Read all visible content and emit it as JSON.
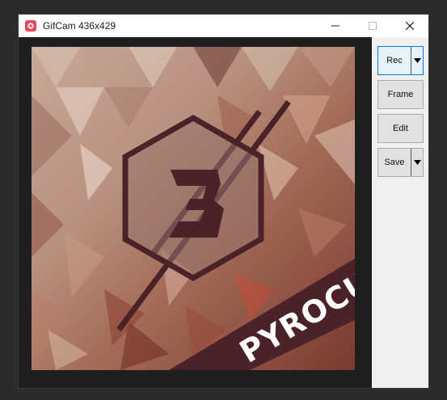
{
  "window": {
    "title": "GifCam 436x429"
  },
  "capture": {
    "overlay_text": "PYROCUY"
  },
  "toolbar": {
    "rec_label": "Rec",
    "frame_label": "Frame",
    "edit_label": "Edit",
    "save_label": "Save"
  },
  "colors": {
    "accent": "#0078d7",
    "banner": "#4a2228",
    "icon_red": "#e8475f"
  },
  "icons": {
    "app": "gifcam-app-icon",
    "minimize": "minimize-icon",
    "maximize": "maximize-icon",
    "close": "close-icon",
    "dropdown": "chevron-down-icon"
  }
}
